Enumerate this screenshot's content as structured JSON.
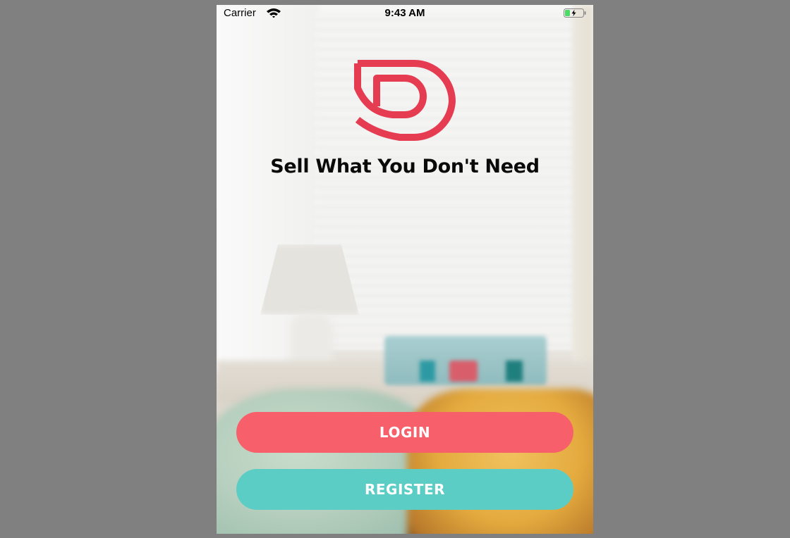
{
  "status_bar": {
    "carrier": "Carrier",
    "time": "9:43 AM",
    "wifi_icon": "wifi-icon",
    "battery_icon": "battery-charging-icon"
  },
  "logo": {
    "icon": "brand-d-logo",
    "color": "#e63c52"
  },
  "tagline": "Sell What You Don't Need",
  "buttons": {
    "login": {
      "label": "LOGIN",
      "color": "#f7606b"
    },
    "register": {
      "label": "REGISTER",
      "color": "#5ccdc5"
    }
  },
  "colors": {
    "desktop_background": "#808080"
  }
}
